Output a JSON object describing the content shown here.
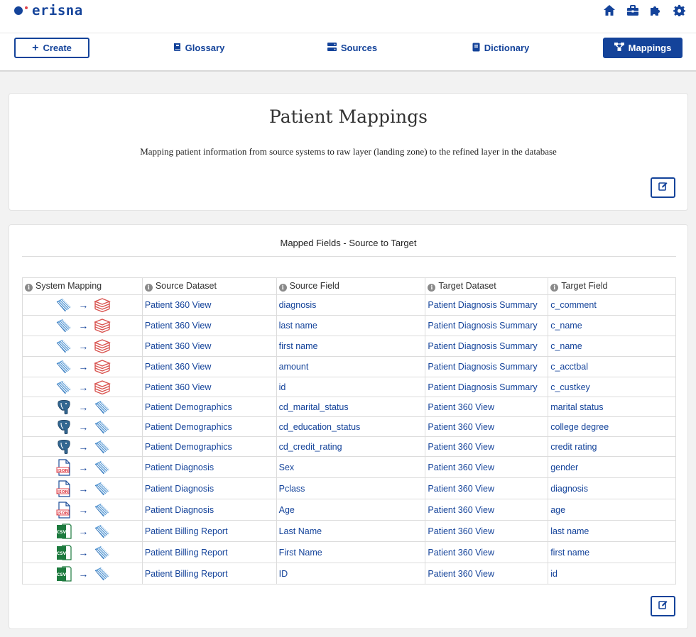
{
  "app": {
    "name": "erisna",
    "accent": "#14439a",
    "dot_color": "#e0454d"
  },
  "top_icons": [
    "home-icon",
    "briefcase-icon",
    "puzzle-icon",
    "gear-icon"
  ],
  "nav": {
    "create": "Create",
    "glossary": "Glossary",
    "sources": "Sources",
    "dictionary": "Dictionary",
    "mappings": "Mappings"
  },
  "header": {
    "title": "Patient Mappings",
    "description": "Mapping patient information from source systems to raw layer (landing zone) to the refined layer in the database"
  },
  "mapped": {
    "title": "Mapped Fields - Source to Target",
    "columns": [
      "System Mapping",
      "Source Dataset",
      "Source Field",
      "Target Dataset",
      "Target Field"
    ],
    "rows": [
      {
        "source_icon": "striped-dataset-icon",
        "target_icon": "database-stack-icon",
        "source_dataset": "Patient 360 View",
        "source_field": "diagnosis",
        "target_dataset": "Patient Diagnosis Summary",
        "target_field": "c_comment"
      },
      {
        "source_icon": "striped-dataset-icon",
        "target_icon": "database-stack-icon",
        "source_dataset": "Patient 360 View",
        "source_field": "last name",
        "target_dataset": "Patient Diagnosis Summary",
        "target_field": "c_name"
      },
      {
        "source_icon": "striped-dataset-icon",
        "target_icon": "database-stack-icon",
        "source_dataset": "Patient 360 View",
        "source_field": "first name",
        "target_dataset": "Patient Diagnosis Summary",
        "target_field": "c_name"
      },
      {
        "source_icon": "striped-dataset-icon",
        "target_icon": "database-stack-icon",
        "source_dataset": "Patient 360 View",
        "source_field": "amount",
        "target_dataset": "Patient Diagnosis Summary",
        "target_field": "c_acctbal"
      },
      {
        "source_icon": "striped-dataset-icon",
        "target_icon": "database-stack-icon",
        "source_dataset": "Patient 360 View",
        "source_field": "id",
        "target_dataset": "Patient Diagnosis Summary",
        "target_field": "c_custkey"
      },
      {
        "source_icon": "postgres-elephant-icon",
        "target_icon": "striped-dataset-icon",
        "source_dataset": "Patient Demographics",
        "source_field": "cd_marital_status",
        "target_dataset": "Patient 360 View",
        "target_field": "marital status"
      },
      {
        "source_icon": "postgres-elephant-icon",
        "target_icon": "striped-dataset-icon",
        "source_dataset": "Patient Demographics",
        "source_field": "cd_education_status",
        "target_dataset": "Patient 360 View",
        "target_field": "college degree"
      },
      {
        "source_icon": "postgres-elephant-icon",
        "target_icon": "striped-dataset-icon",
        "source_dataset": "Patient Demographics",
        "source_field": "cd_credit_rating",
        "target_dataset": "Patient 360 View",
        "target_field": "credit rating"
      },
      {
        "source_icon": "json-file-icon",
        "target_icon": "striped-dataset-icon",
        "source_dataset": "Patient Diagnosis",
        "source_field": "Sex",
        "target_dataset": "Patient 360 View",
        "target_field": "gender"
      },
      {
        "source_icon": "json-file-icon",
        "target_icon": "striped-dataset-icon",
        "source_dataset": "Patient Diagnosis",
        "source_field": "Pclass",
        "target_dataset": "Patient 360 View",
        "target_field": "diagnosis"
      },
      {
        "source_icon": "json-file-icon",
        "target_icon": "striped-dataset-icon",
        "source_dataset": "Patient Diagnosis",
        "source_field": "Age",
        "target_dataset": "Patient 360 View",
        "target_field": "age"
      },
      {
        "source_icon": "csv-file-icon",
        "target_icon": "striped-dataset-icon",
        "source_dataset": "Patient Billing Report",
        "source_field": "Last Name",
        "target_dataset": "Patient 360 View",
        "target_field": "last name"
      },
      {
        "source_icon": "csv-file-icon",
        "target_icon": "striped-dataset-icon",
        "source_dataset": "Patient Billing Report",
        "source_field": "First Name",
        "target_dataset": "Patient 360 View",
        "target_field": "first name"
      },
      {
        "source_icon": "csv-file-icon",
        "target_icon": "striped-dataset-icon",
        "source_dataset": "Patient Billing Report",
        "source_field": "ID",
        "target_dataset": "Patient 360 View",
        "target_field": "id"
      }
    ],
    "icon_labels": {
      "json": "JSON",
      "csv": "CSV"
    }
  }
}
